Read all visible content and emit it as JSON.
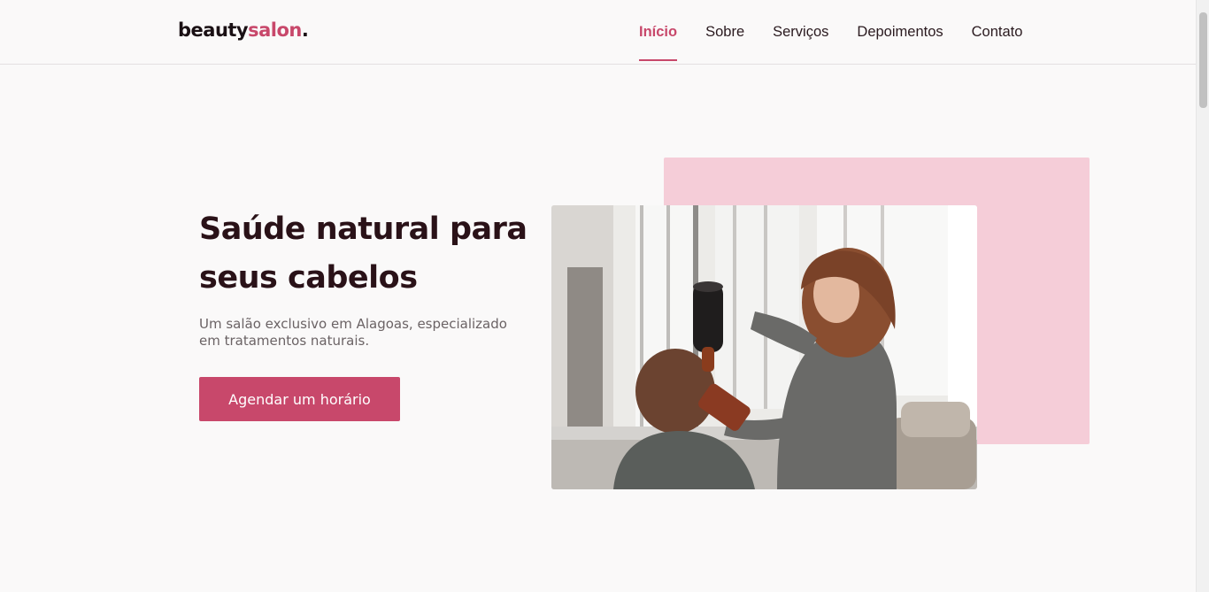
{
  "brand": {
    "part1": "beauty",
    "part2": "salon",
    "dot": "."
  },
  "nav": {
    "items": [
      {
        "label": "Início",
        "active": true
      },
      {
        "label": "Sobre"
      },
      {
        "label": "Serviços"
      },
      {
        "label": "Depoimentos"
      },
      {
        "label": "Contato"
      }
    ]
  },
  "hero": {
    "title_line1": "Saúde natural para",
    "title_line2": "seus cabelos",
    "subtitle": "Um salão exclusivo em Alagoas, especializado em tratamentos naturais.",
    "cta_label": "Agendar um horário",
    "image_icon": "salon-photo"
  },
  "colors": {
    "accent": "#c8486b",
    "pink_block": "#f5cdd8",
    "background": "#faf9f9",
    "heading": "#2a1218"
  }
}
